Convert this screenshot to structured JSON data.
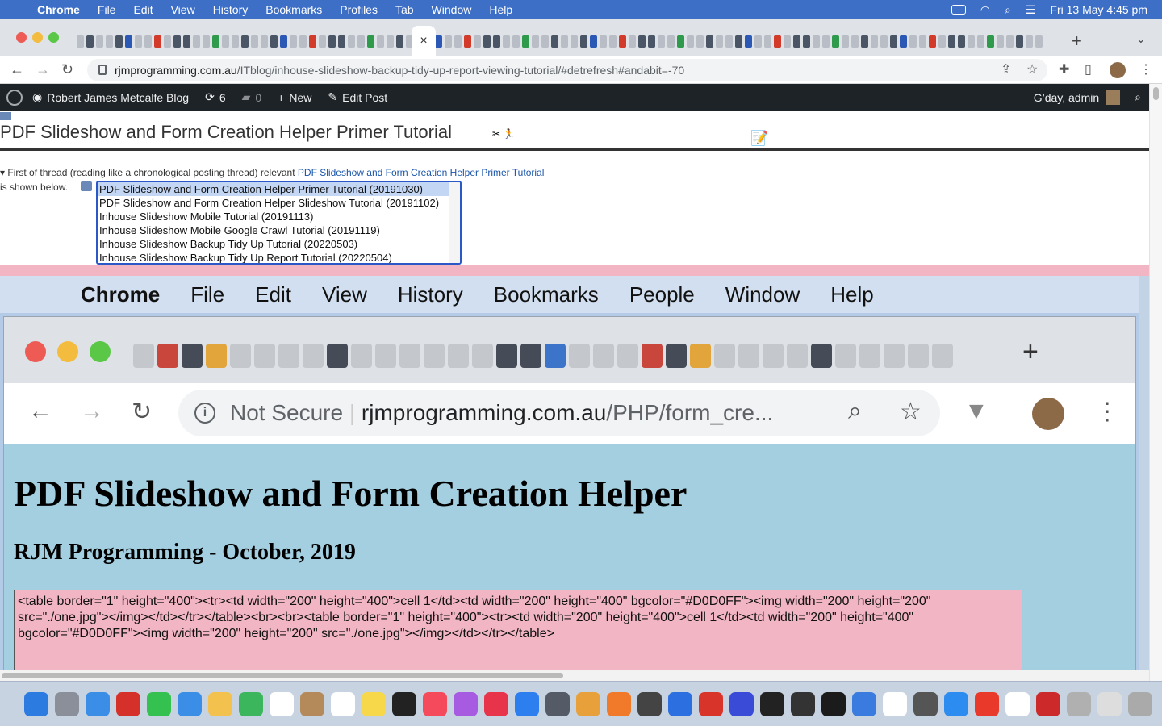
{
  "menubar": {
    "app": "Chrome",
    "items": [
      "File",
      "Edit",
      "View",
      "History",
      "Bookmarks",
      "Profiles",
      "Tab",
      "Window",
      "Help"
    ],
    "datetime": "Fri 13 May  4:45 pm"
  },
  "toolbar": {
    "url_host": "rjmprogramming.com.au",
    "url_path": "/ITblog/inhouse-slideshow-backup-tidy-up-report-viewing-tutorial/#detrefresh#andabit=-70",
    "active_tab_close": "×",
    "new_tab": "+"
  },
  "wpbar": {
    "site_name": "Robert James Metcalfe Blog",
    "updates_count": "6",
    "comments_count": "0",
    "new_label": "New",
    "edit_label": "Edit Post",
    "greeting": "G’day, admin"
  },
  "post": {
    "title": "PDF Slideshow and Form Creation Helper Primer Tutorial",
    "thread_intro": "First of thread (reading like a chronological posting thread) relevant",
    "thread_link": "PDF Slideshow and Form Creation Helper Primer Tutorial",
    "shown_below": "is shown below.",
    "thread_options": [
      "PDF Slideshow and Form Creation Helper Primer Tutorial (20191030)",
      "PDF Slideshow and Form Creation Helper Slideshow Tutorial (20191102)",
      "Inhouse Slideshow Mobile Tutorial (20191113)",
      "Inhouse Slideshow Mobile Google Crawl Tutorial (20191119)",
      "Inhouse Slideshow Backup Tidy Up Tutorial (20220503)",
      "Inhouse Slideshow Backup Tidy Up Report Tutorial (20220504)"
    ],
    "selected_option": 0
  },
  "embedded": {
    "menubar": {
      "app": "Chrome",
      "items": [
        "File",
        "Edit",
        "View",
        "History",
        "Bookmarks",
        "People",
        "Window",
        "Help"
      ]
    },
    "not_secure": "Not Secure",
    "url_host": "rjmprogramming.com.au",
    "url_path": "/PHP/form_cre...",
    "page_title": "PDF Slideshow and Form Creation Helper",
    "page_subtitle": "RJM Programming - October, 2019",
    "code_text": "<table border=\"1\" height=\"400\"><tr><td width=\"200\" height=\"400\">cell 1</td><td width=\"200\" height=\"400\" bgcolor=\"#D0D0FF\"><img width=\"200\" height=\"200\" src=\"./one.jpg\"></img></td></tr></table><br><br><table border=\"1\" height=\"400\"><tr><td width=\"200\" height=\"400\">cell 1</td><td width=\"200\" height=\"400\" bgcolor=\"#D0D0FF\"><img width=\"200\" height=\"200\" src=\"./one.jpg\"></img></td></tr></table>"
  },
  "colors": {
    "mac_menubar": "#3d6fc7",
    "wp_adminbar": "#1d2327",
    "pink_band": "#f1b5c3",
    "embedded_page_bg": "#a3cfe0",
    "listbox_border": "#2a58c6"
  }
}
